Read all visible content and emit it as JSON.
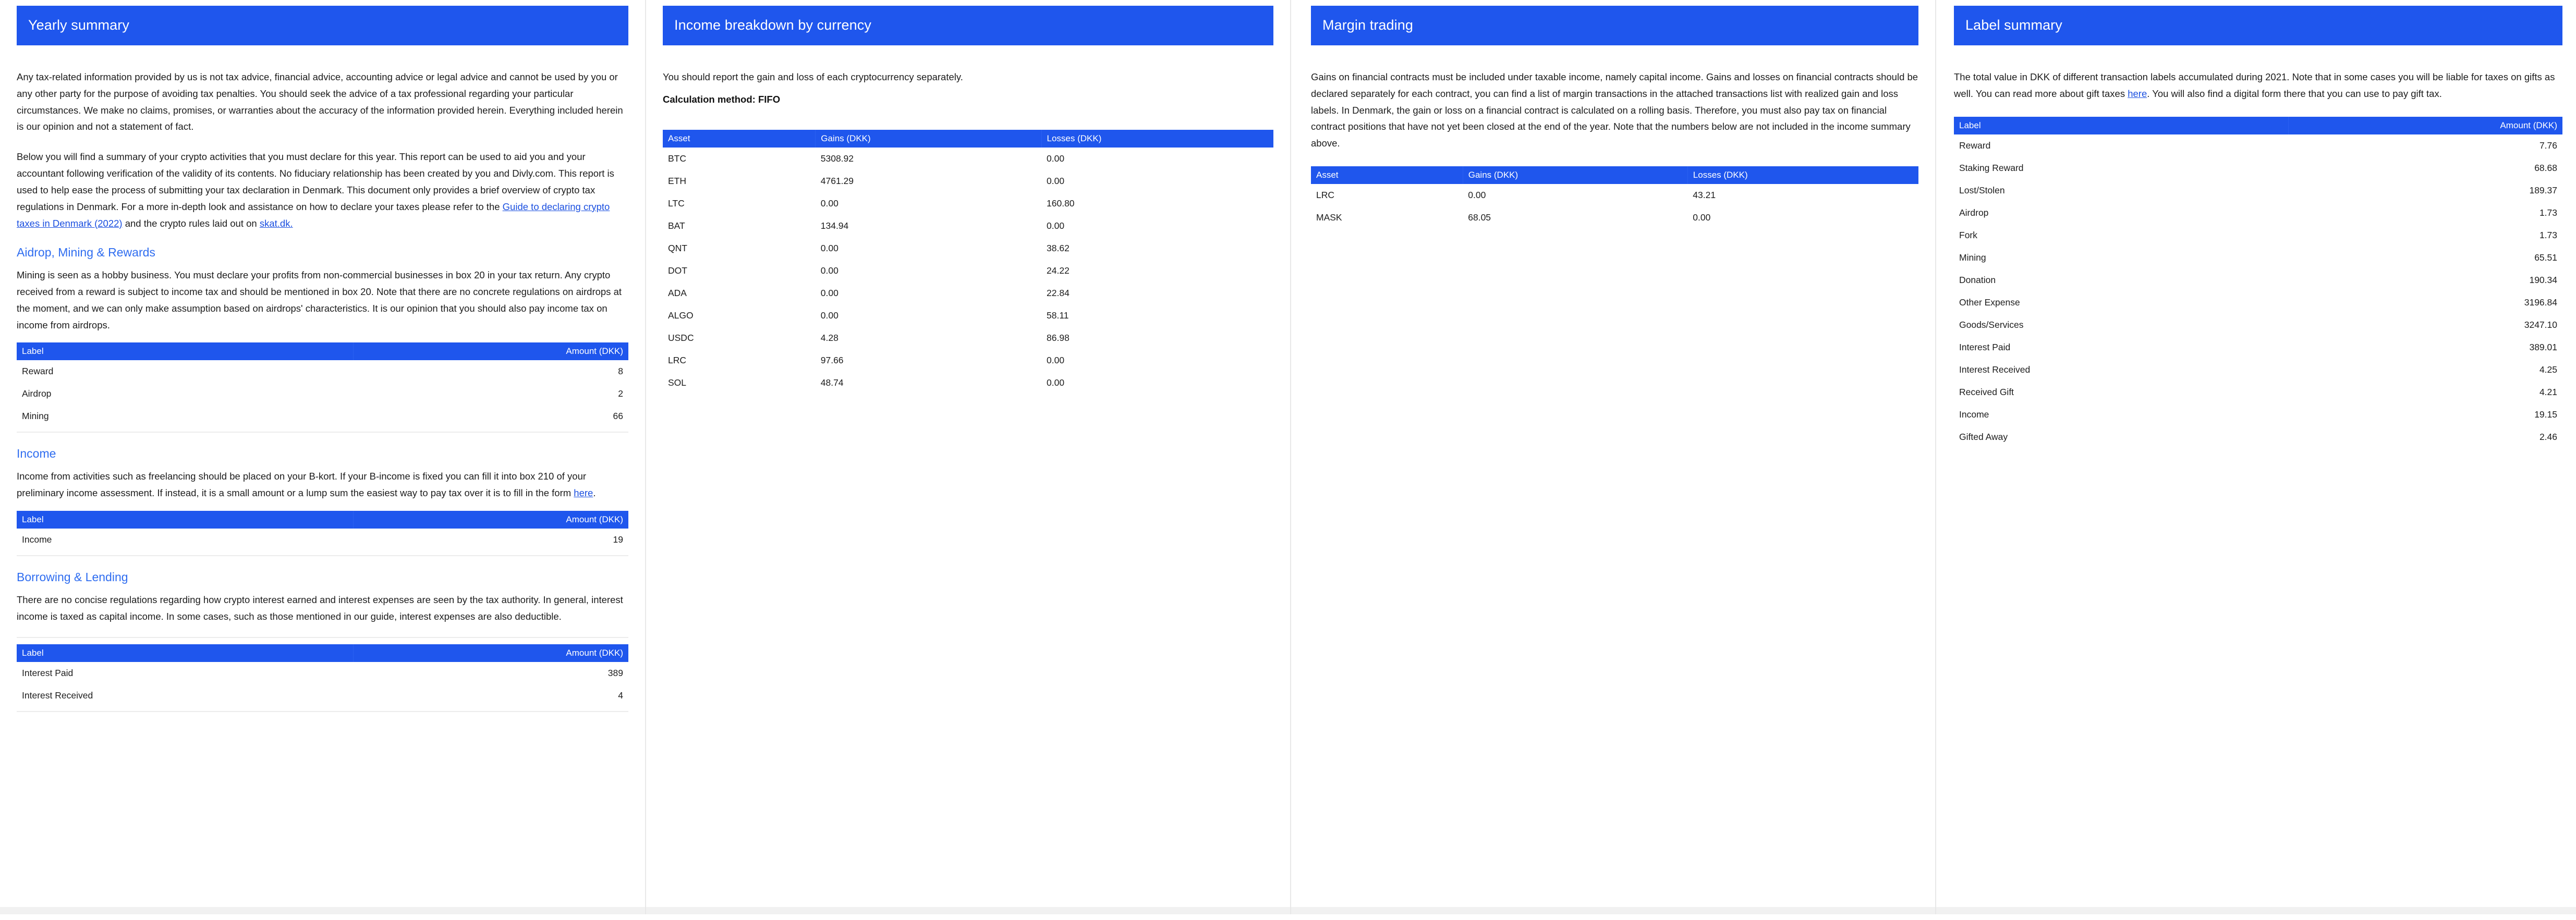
{
  "theme": {
    "accent": "#1f56ed",
    "link": "#1a4fe0",
    "heading": "#2f6df0",
    "text": "#1c1c1c",
    "rule": "#ececec"
  },
  "page1": {
    "banner_title": "Yearly summary",
    "disclaimer": "Any tax-related information provided by us is not tax advice, financial advice, accounting advice or legal advice and cannot be used by you or any other party for the purpose of avoiding tax penalties. You should seek the advice of a tax professional regarding your particular circumstances. We make no claims, promises, or warranties about the accuracy of the information provided herein. Everything included herein is our opinion and not a statement of fact.",
    "intro_part1": "Below you will find a summary of your crypto activities that you must declare for this year. This report can be used to aid you and your accountant following verification of the validity of its contents. No fiduciary relationship has been created by you and Divly.com. This report is used to help ease the process of submitting your tax declaration in Denmark. This document only provides a brief overview of crypto tax regulations in Denmark. For a more in-depth look and assistance on how to declare your taxes please refer to the ",
    "intro_link1": "Guide to declaring crypto taxes in Denmark (2022)",
    "intro_part2": " and the crypto rules laid out on ",
    "intro_link2": "skat.dk.",
    "airdrop_section": {
      "heading": "Aidrop, Mining & Rewards",
      "body": "Mining is seen as a hobby business. You must declare your profits from non-commercial businesses in box 20 in your tax return. Any crypto received from a reward is subject to income tax and should be mentioned in box 20. Note that there are no concrete regulations on airdrops at the moment, and we can only make assumption based on airdrops' characteristics. It is our opinion that you should also pay income tax on income from airdrops.",
      "table": {
        "headers": [
          "Label",
          "Amount (DKK)"
        ],
        "rows": [
          [
            "Reward",
            "8"
          ],
          [
            "Airdrop",
            "2"
          ],
          [
            "Mining",
            "66"
          ]
        ]
      }
    },
    "income_section": {
      "heading": "Income",
      "body_part1": "Income from activities such as freelancing should be placed on your B-kort. If your B-income is fixed you can fill it into box 210 of your preliminary income assessment. If instead, it is a small amount or a lump sum the easiest way to pay tax over it is to fill in the form ",
      "body_link": "here",
      "body_part2": ".",
      "table": {
        "headers": [
          "Label",
          "Amount (DKK)"
        ],
        "rows": [
          [
            "Income",
            "19"
          ]
        ]
      }
    },
    "lending_section": {
      "heading": "Borrowing & Lending",
      "body": "There are no concise regulations regarding how crypto interest earned and interest expenses are seen by the tax authority. In general, interest income is taxed as capital income. In some cases, such as those mentioned in our guide, interest expenses are also deductible.",
      "table": {
        "headers": [
          "Label",
          "Amount (DKK)"
        ],
        "rows": [
          [
            "Interest Paid",
            "389"
          ],
          [
            "Interest Received",
            "4"
          ]
        ]
      }
    }
  },
  "page2": {
    "banner_title": "Income breakdown by currency",
    "body": "You should report the gain and loss of each cryptocurrency separately.",
    "calculation_method": "Calculation method: FIFO",
    "table": {
      "headers": [
        "Asset",
        "Gains (DKK)",
        "Losses (DKK)"
      ],
      "rows": [
        [
          "BTC",
          "5308.92",
          "0.00"
        ],
        [
          "ETH",
          "4761.29",
          "0.00"
        ],
        [
          "LTC",
          "0.00",
          "160.80"
        ],
        [
          "BAT",
          "134.94",
          "0.00"
        ],
        [
          "QNT",
          "0.00",
          "38.62"
        ],
        [
          "DOT",
          "0.00",
          "24.22"
        ],
        [
          "ADA",
          "0.00",
          "22.84"
        ],
        [
          "ALGO",
          "0.00",
          "58.11"
        ],
        [
          "USDC",
          "4.28",
          "86.98"
        ],
        [
          "LRC",
          "97.66",
          "0.00"
        ],
        [
          "SOL",
          "48.74",
          "0.00"
        ]
      ]
    }
  },
  "page3": {
    "banner_title": "Margin trading",
    "body": "Gains on financial contracts must be included under taxable income, namely capital income. Gains and losses on financial contracts should be declared separately for each contract, you can find a list of margin transactions in the attached transactions list with realized gain and loss labels. In Denmark, the gain or loss on a financial contract is calculated on a rolling basis. Therefore, you must also pay tax on financial contract positions that have not yet been closed at the end of the year. Note that the numbers below are not included in the income summary above.",
    "table": {
      "headers": [
        "Asset",
        "Gains (DKK)",
        "Losses (DKK)"
      ],
      "rows": [
        [
          "LRC",
          "0.00",
          "43.21"
        ],
        [
          "MASK",
          "68.05",
          "0.00"
        ]
      ]
    }
  },
  "page4": {
    "banner_title": "Label summary",
    "body_part1": "The total value in DKK of different transaction labels accumulated during 2021. Note that in some cases you will be liable for taxes on gifts as well. You can read more about gift taxes ",
    "body_link": "here",
    "body_part2": ". You will also find a digital form there that you can use to pay gift tax.",
    "table": {
      "headers": [
        "Label",
        "Amount (DKK)"
      ],
      "rows": [
        [
          "Reward",
          "7.76"
        ],
        [
          "Staking Reward",
          "68.68"
        ],
        [
          "Lost/Stolen",
          "189.37"
        ],
        [
          "Airdrop",
          "1.73"
        ],
        [
          "Fork",
          "1.73"
        ],
        [
          "Mining",
          "65.51"
        ],
        [
          "Donation",
          "190.34"
        ],
        [
          "Other Expense",
          "3196.84"
        ],
        [
          "Goods/Services",
          "3247.10"
        ],
        [
          "Interest Paid",
          "389.01"
        ],
        [
          "Interest Received",
          "4.25"
        ],
        [
          "Received Gift",
          "4.21"
        ],
        [
          "Income",
          "19.15"
        ],
        [
          "Gifted Away",
          "2.46"
        ]
      ]
    }
  }
}
